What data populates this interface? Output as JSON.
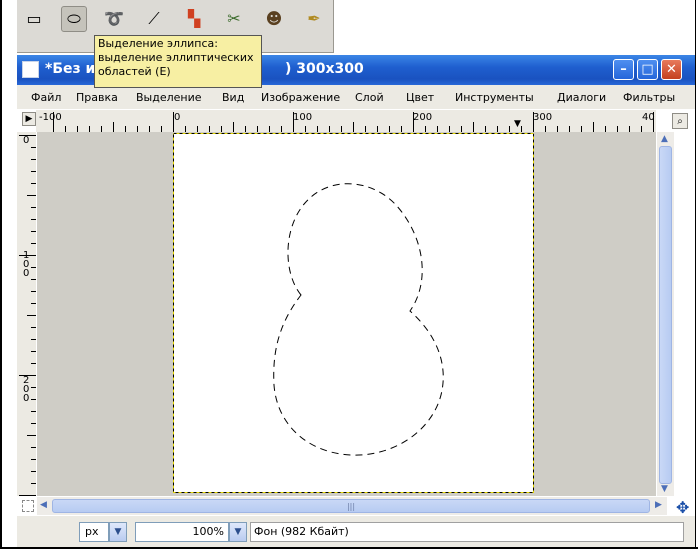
{
  "toolbox": {
    "tools": [
      {
        "name": "rect-select-icon",
        "glyph": "▭",
        "active": false
      },
      {
        "name": "ellipse-select-icon",
        "glyph": "⬭",
        "active": true
      },
      {
        "name": "free-select-icon",
        "glyph": "➰",
        "active": false
      },
      {
        "name": "fuzzy-select-icon",
        "glyph": "⟋",
        "active": false
      },
      {
        "name": "select-by-color-icon",
        "glyph": "▚",
        "active": false
      },
      {
        "name": "scissors-select-icon",
        "glyph": "✂",
        "active": false
      },
      {
        "name": "foreground-select-icon",
        "glyph": "☻",
        "active": false
      },
      {
        "name": "paths-tool-icon",
        "glyph": "✒",
        "active": false
      }
    ]
  },
  "tooltip": {
    "line1": "Выделение эллипса:",
    "line2": "выделение эллиптических",
    "line3": "областей  (E)"
  },
  "window": {
    "title_prefix": "*Без и",
    "title_suffix": ") 300x300",
    "minimize_label": "–",
    "maximize_label": "□",
    "close_label": "✕"
  },
  "menu": [
    "Файл",
    "Правка",
    "Выделение",
    "Вид",
    "Изображение",
    "Слой",
    "Цвет",
    "Инструменты",
    "Диалоги",
    "Фильтры"
  ],
  "ruler": {
    "h_labels": [
      "-100",
      "0",
      "100",
      "200",
      "300",
      "40"
    ],
    "v_labels": [
      "0",
      "100",
      "200"
    ]
  },
  "statusbar": {
    "unit": "px",
    "zoom": "100%",
    "layer_info": "Фон (982 Кбайт)"
  },
  "colors": {
    "titlebar": "#1f5fcf",
    "selection_border": "#e6d800",
    "tooltip_bg": "#f7efa3"
  }
}
